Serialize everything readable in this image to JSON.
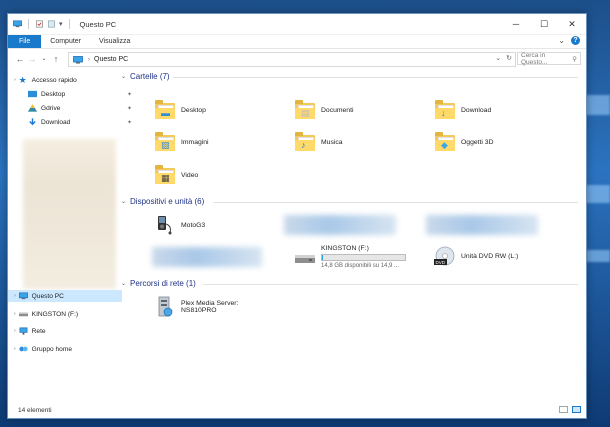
{
  "window": {
    "title": "Questo PC",
    "controls": {
      "minimize": "─",
      "maximize": "☐",
      "close": "✕"
    }
  },
  "ribbon": {
    "tabs": [
      "File",
      "Computer",
      "Visualizza"
    ],
    "expand_glyph": "⌄",
    "help_glyph": "?"
  },
  "address": {
    "back": "←",
    "forward": "→",
    "recent": "⌄",
    "up": "↑",
    "separator": "›",
    "location": "Questo PC",
    "dropdown": "⌄",
    "refresh": "↻",
    "search_placeholder": "Cerca in Questo...",
    "search_icon": "⚲"
  },
  "sidebar": {
    "quick_access": "Accesso rapido",
    "pinned": [
      {
        "label": "Desktop",
        "icon": "desktop-icon"
      },
      {
        "label": "Gdrive",
        "icon": "gdrive-icon"
      },
      {
        "label": "Download",
        "icon": "download-icon"
      }
    ],
    "pin_glyph": "📌",
    "this_pc": "Questo PC",
    "drive": "KINGSTON (F:)",
    "network": "Rete",
    "homegroup": "Gruppo home"
  },
  "groups": {
    "folders": "Cartelle (7)",
    "devices": "Dispositivi e unità (6)",
    "network": "Percorsi di rete (1)"
  },
  "folders": [
    {
      "label": "Desktop",
      "icon": "desktop-folder-icon"
    },
    {
      "label": "Documenti",
      "icon": "documents-folder-icon"
    },
    {
      "label": "Download",
      "icon": "download-folder-icon"
    },
    {
      "label": "Immagini",
      "icon": "pictures-folder-icon"
    },
    {
      "label": "Musica",
      "icon": "music-folder-icon"
    },
    {
      "label": "Oggetti 3D",
      "icon": "3d-objects-folder-icon"
    },
    {
      "label": "Video",
      "icon": "video-folder-icon"
    }
  ],
  "devices": {
    "phone": "MotoG3",
    "usb": {
      "label": "KINGSTON (F:)",
      "free_text": "14,8 GB disponibili su 14,9 ...",
      "used_fraction": 0.01
    },
    "dvd": "Unità DVD RW (L:)",
    "dvd_badge": "DVD"
  },
  "network_locations": [
    {
      "line1": "Plex Media Server:",
      "line2": "NS810PRO"
    }
  ],
  "status": {
    "count": "14 elementi"
  },
  "colors": {
    "accent": "#1979ca",
    "group_heading": "#1e3287",
    "selection": "#cce8ff"
  }
}
